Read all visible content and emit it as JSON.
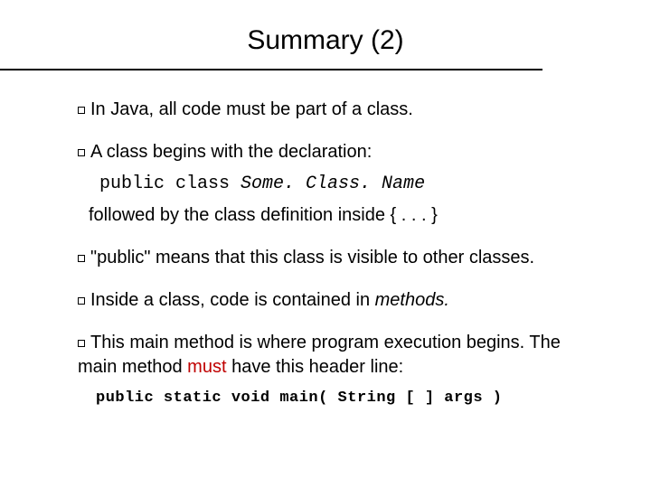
{
  "title": "Summary (2)",
  "bullets": {
    "b1": "In Java, all code must be part of a class.",
    "b2": "A class begins with the declaration:",
    "b2_code_prefix": "public class ",
    "b2_code_name": "Some. Class. Name",
    "b2_follow_a": "followed by the class definition inside {",
    "b2_follow_b": " . . .   }",
    "b3": "\"public\" means that this class is visible to other classes.",
    "b4_a": "Inside a class, code is contained in ",
    "b4_b": "methods.",
    "b5_a": "This main method is where program execution begins. The main method ",
    "b5_must": "must",
    "b5_b": " have this header line:",
    "b5_code": "public static void main( String [ ] args )"
  }
}
